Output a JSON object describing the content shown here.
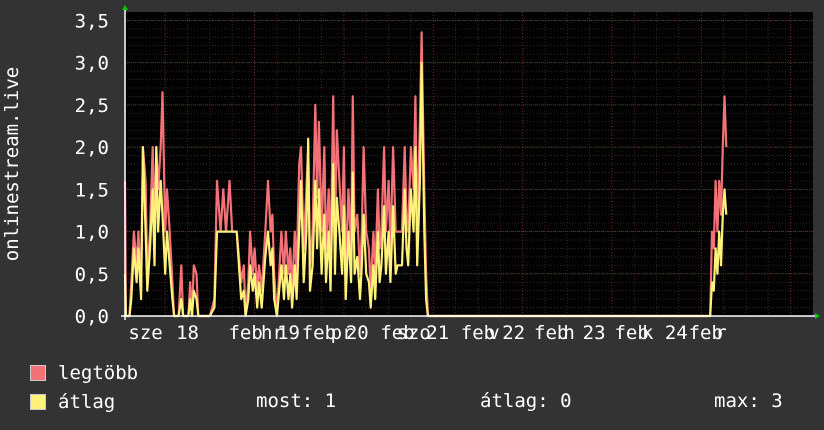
{
  "colors": {
    "background": "#333333",
    "plot_background": "#000000",
    "grid": "#4a2a2a",
    "axis": "#ffffff",
    "arrow": "#00cc00",
    "max_series": "#f27278",
    "avg_series": "#fff27a"
  },
  "legend": {
    "max_label": "legtöbb",
    "avg_label": "átlag",
    "now_label": "most: 1",
    "avg_stat_label": "átlag: 0",
    "max_stat_label": "max: 3"
  },
  "chart_data": {
    "type": "line",
    "ylabel": "onlinestream.live",
    "ylim": [
      0,
      3.6
    ],
    "yticks": [
      "0,0",
      "0,5",
      "1,0",
      "1,5",
      "2,0",
      "2,5",
      "3,0",
      "3,5"
    ],
    "xlim": [
      17.55,
      25.25
    ],
    "x_tick_labels": [
      {
        "x": 17.78,
        "label": "sze"
      },
      {
        "x": 18.25,
        "label": "18"
      },
      {
        "x": 18.9,
        "label": "feb"
      },
      {
        "x": 19.2,
        "label": "hr"
      },
      {
        "x": 19.38,
        "label": "19"
      },
      {
        "x": 19.72,
        "label": "feb"
      },
      {
        "x": 19.98,
        "label": "pr"
      },
      {
        "x": 20.15,
        "label": "20"
      },
      {
        "x": 20.6,
        "label": "feb"
      },
      {
        "x": 20.78,
        "label": "szo"
      },
      {
        "x": 21.05,
        "label": "21"
      },
      {
        "x": 21.5,
        "label": "feb"
      },
      {
        "x": 21.68,
        "label": "v"
      },
      {
        "x": 21.9,
        "label": "22"
      },
      {
        "x": 22.32,
        "label": "feb"
      },
      {
        "x": 22.52,
        "label": "h"
      },
      {
        "x": 22.8,
        "label": "23"
      },
      {
        "x": 23.22,
        "label": "feb"
      },
      {
        "x": 23.4,
        "label": "k"
      },
      {
        "x": 23.72,
        "label": "24"
      },
      {
        "x": 24.05,
        "label": "feb"
      },
      {
        "x": 24.22,
        "label": "r"
      }
    ],
    "series": [
      {
        "name": "legtöbb",
        "color": "#f27278",
        "points": [
          [
            17.55,
            1.6
          ],
          [
            17.56,
            0
          ],
          [
            17.6,
            0
          ],
          [
            17.62,
            0.4
          ],
          [
            17.65,
            1.0
          ],
          [
            17.68,
            0.6
          ],
          [
            17.7,
            1.0
          ],
          [
            17.73,
            0.3
          ],
          [
            17.75,
            2.0
          ],
          [
            17.78,
            1.6
          ],
          [
            17.8,
            0.5
          ],
          [
            17.83,
            1.0
          ],
          [
            17.86,
            2.0
          ],
          [
            17.88,
            0.9
          ],
          [
            17.9,
            2.0
          ],
          [
            17.92,
            1.5
          ],
          [
            17.95,
            2.0
          ],
          [
            17.97,
            2.65
          ],
          [
            18.0,
            1.0
          ],
          [
            18.02,
            1.5
          ],
          [
            18.05,
            1.0
          ],
          [
            18.08,
            0.4
          ],
          [
            18.1,
            0
          ],
          [
            18.15,
            0
          ],
          [
            18.18,
            0.6
          ],
          [
            18.2,
            0
          ],
          [
            18.26,
            0
          ],
          [
            18.28,
            0.4
          ],
          [
            18.3,
            0
          ],
          [
            18.32,
            0.6
          ],
          [
            18.35,
            0.5
          ],
          [
            18.37,
            0
          ],
          [
            18.5,
            0
          ],
          [
            18.55,
            0.2
          ],
          [
            18.58,
            1.6
          ],
          [
            18.62,
            1.0
          ],
          [
            18.65,
            1.5
          ],
          [
            18.68,
            1.0
          ],
          [
            18.72,
            1.6
          ],
          [
            18.75,
            1.0
          ],
          [
            18.8,
            1.0
          ],
          [
            18.85,
            0.4
          ],
          [
            18.88,
            0.6
          ],
          [
            18.9,
            0
          ],
          [
            18.93,
            0.4
          ],
          [
            18.95,
            1.0
          ],
          [
            18.98,
            0.5
          ],
          [
            19.0,
            0.8
          ],
          [
            19.03,
            0.3
          ],
          [
            19.05,
            0.6
          ],
          [
            19.08,
            0.3
          ],
          [
            19.12,
            1.0
          ],
          [
            19.15,
            1.6
          ],
          [
            19.18,
            1.0
          ],
          [
            19.2,
            1.2
          ],
          [
            19.22,
            0.5
          ],
          [
            19.25,
            0
          ],
          [
            19.3,
            1.0
          ],
          [
            19.33,
            0.5
          ],
          [
            19.35,
            1.0
          ],
          [
            19.38,
            0.5
          ],
          [
            19.4,
            0.8
          ],
          [
            19.42,
            0.3
          ],
          [
            19.45,
            1.0
          ],
          [
            19.47,
            0.5
          ],
          [
            19.5,
            1.8
          ],
          [
            19.52,
            2.0
          ],
          [
            19.55,
            0.8
          ],
          [
            19.58,
            1.5
          ],
          [
            19.6,
            2.0
          ],
          [
            19.62,
            0.6
          ],
          [
            19.65,
            1.0
          ],
          [
            19.68,
            2.5
          ],
          [
            19.7,
            1.4
          ],
          [
            19.72,
            2.3
          ],
          [
            19.75,
            1.0
          ],
          [
            19.78,
            2.0
          ],
          [
            19.8,
            0.8
          ],
          [
            19.83,
            1.5
          ],
          [
            19.85,
            0.6
          ],
          [
            19.88,
            2.6
          ],
          [
            19.9,
            1.0
          ],
          [
            19.92,
            2.2
          ],
          [
            19.95,
            1.6
          ],
          [
            19.98,
            1.0
          ],
          [
            20.0,
            2.0
          ],
          [
            20.02,
            0.5
          ],
          [
            20.05,
            1.5
          ],
          [
            20.08,
            0.8
          ],
          [
            20.1,
            2.6
          ],
          [
            20.12,
            1.0
          ],
          [
            20.15,
            1.2
          ],
          [
            20.18,
            0.5
          ],
          [
            20.2,
            1.0
          ],
          [
            20.22,
            2.0
          ],
          [
            20.25,
            1.0
          ],
          [
            20.28,
            0.8
          ],
          [
            20.3,
            0.3
          ],
          [
            20.33,
            1.0
          ],
          [
            20.35,
            0.5
          ],
          [
            20.38,
            1.5
          ],
          [
            20.4,
            0.8
          ],
          [
            20.42,
            1.0
          ],
          [
            20.45,
            2.0
          ],
          [
            20.47,
            1.0
          ],
          [
            20.5,
            1.6
          ],
          [
            20.52,
            0.8
          ],
          [
            20.55,
            2.0
          ],
          [
            20.58,
            1.0
          ],
          [
            20.6,
            1.0
          ],
          [
            20.65,
            1.0
          ],
          [
            20.68,
            2.0
          ],
          [
            20.7,
            1.2
          ],
          [
            20.72,
            1.0
          ],
          [
            20.75,
            2.0
          ],
          [
            20.78,
            1.5
          ],
          [
            20.8,
            2.6
          ],
          [
            20.82,
            1.0
          ],
          [
            20.85,
            2.3
          ],
          [
            20.87,
            3.36
          ],
          [
            20.9,
            1.5
          ],
          [
            20.92,
            0.5
          ],
          [
            20.94,
            0
          ],
          [
            22.8,
            0
          ],
          [
            24.1,
            0
          ],
          [
            24.12,
            1.0
          ],
          [
            24.14,
            0.8
          ],
          [
            24.16,
            1.6
          ],
          [
            24.18,
            1.0
          ],
          [
            24.2,
            1.6
          ],
          [
            24.22,
            1.2
          ],
          [
            24.24,
            2.0
          ],
          [
            24.26,
            2.6
          ],
          [
            24.28,
            2.0
          ]
        ]
      },
      {
        "name": "átlag",
        "color": "#fff27a",
        "points": [
          [
            17.55,
            0.5
          ],
          [
            17.56,
            0
          ],
          [
            17.6,
            0
          ],
          [
            17.62,
            0.2
          ],
          [
            17.65,
            0.8
          ],
          [
            17.68,
            0.4
          ],
          [
            17.7,
            0.8
          ],
          [
            17.73,
            0.2
          ],
          [
            17.75,
            2.0
          ],
          [
            17.78,
            1.0
          ],
          [
            17.8,
            0.3
          ],
          [
            17.83,
            0.8
          ],
          [
            17.86,
            1.5
          ],
          [
            17.88,
            0.6
          ],
          [
            17.9,
            2.0
          ],
          [
            17.92,
            1.0
          ],
          [
            17.95,
            1.6
          ],
          [
            17.97,
            1.2
          ],
          [
            18.0,
            0.5
          ],
          [
            18.02,
            1.0
          ],
          [
            18.05,
            0.6
          ],
          [
            18.08,
            0.2
          ],
          [
            18.1,
            0
          ],
          [
            18.15,
            0
          ],
          [
            18.18,
            0.2
          ],
          [
            18.2,
            0
          ],
          [
            18.26,
            0
          ],
          [
            18.28,
            0.2
          ],
          [
            18.3,
            0
          ],
          [
            18.32,
            0.3
          ],
          [
            18.35,
            0.2
          ],
          [
            18.37,
            0
          ],
          [
            18.5,
            0
          ],
          [
            18.55,
            0.1
          ],
          [
            18.58,
            1.0
          ],
          [
            18.62,
            1.0
          ],
          [
            18.65,
            1.0
          ],
          [
            18.68,
            1.0
          ],
          [
            18.72,
            1.0
          ],
          [
            18.75,
            1.0
          ],
          [
            18.8,
            1.0
          ],
          [
            18.85,
            0.2
          ],
          [
            18.88,
            0.3
          ],
          [
            18.9,
            0
          ],
          [
            18.93,
            0.2
          ],
          [
            18.95,
            0.6
          ],
          [
            18.98,
            0.3
          ],
          [
            19.0,
            0.5
          ],
          [
            19.03,
            0.1
          ],
          [
            19.05,
            0.4
          ],
          [
            19.08,
            0.1
          ],
          [
            19.12,
            0.7
          ],
          [
            19.15,
            1.0
          ],
          [
            19.18,
            0.6
          ],
          [
            19.2,
            0.8
          ],
          [
            19.22,
            0.2
          ],
          [
            19.25,
            0
          ],
          [
            19.3,
            0.6
          ],
          [
            19.33,
            0.2
          ],
          [
            19.35,
            0.6
          ],
          [
            19.38,
            0.2
          ],
          [
            19.4,
            0.5
          ],
          [
            19.42,
            0.1
          ],
          [
            19.45,
            0.6
          ],
          [
            19.47,
            0.2
          ],
          [
            19.5,
            1.0
          ],
          [
            19.52,
            1.6
          ],
          [
            19.55,
            0.4
          ],
          [
            19.58,
            1.0
          ],
          [
            19.6,
            2.1
          ],
          [
            19.62,
            0.3
          ],
          [
            19.65,
            0.6
          ],
          [
            19.68,
            1.6
          ],
          [
            19.7,
            0.8
          ],
          [
            19.72,
            1.5
          ],
          [
            19.75,
            0.5
          ],
          [
            19.78,
            1.2
          ],
          [
            19.8,
            0.4
          ],
          [
            19.83,
            1.0
          ],
          [
            19.85,
            0.3
          ],
          [
            19.88,
            1.8
          ],
          [
            19.9,
            0.5
          ],
          [
            19.92,
            1.4
          ],
          [
            19.95,
            1.0
          ],
          [
            19.98,
            0.5
          ],
          [
            20.0,
            1.3
          ],
          [
            20.02,
            0.2
          ],
          [
            20.05,
            1.0
          ],
          [
            20.08,
            0.4
          ],
          [
            20.1,
            1.7
          ],
          [
            20.12,
            0.5
          ],
          [
            20.15,
            0.7
          ],
          [
            20.18,
            0.2
          ],
          [
            20.2,
            0.6
          ],
          [
            20.22,
            1.2
          ],
          [
            20.25,
            0.5
          ],
          [
            20.28,
            0.4
          ],
          [
            20.3,
            0.1
          ],
          [
            20.33,
            0.6
          ],
          [
            20.35,
            0.2
          ],
          [
            20.38,
            1.0
          ],
          [
            20.4,
            0.4
          ],
          [
            20.42,
            0.6
          ],
          [
            20.45,
            1.3
          ],
          [
            20.47,
            0.5
          ],
          [
            20.5,
            1.0
          ],
          [
            20.52,
            0.4
          ],
          [
            20.55,
            1.3
          ],
          [
            20.58,
            0.5
          ],
          [
            20.6,
            0.6
          ],
          [
            20.65,
            0.6
          ],
          [
            20.68,
            1.5
          ],
          [
            20.7,
            0.8
          ],
          [
            20.72,
            0.6
          ],
          [
            20.75,
            1.5
          ],
          [
            20.78,
            1.0
          ],
          [
            20.8,
            2.0
          ],
          [
            20.82,
            0.6
          ],
          [
            20.85,
            1.6
          ],
          [
            20.87,
            3.0
          ],
          [
            20.9,
            1.0
          ],
          [
            20.92,
            0.2
          ],
          [
            20.94,
            0
          ],
          [
            22.8,
            0
          ],
          [
            24.1,
            0
          ],
          [
            24.12,
            0.4
          ],
          [
            24.14,
            0.3
          ],
          [
            24.16,
            0.8
          ],
          [
            24.18,
            0.5
          ],
          [
            24.2,
            1.0
          ],
          [
            24.22,
            0.6
          ],
          [
            24.24,
            1.2
          ],
          [
            24.26,
            1.5
          ],
          [
            24.28,
            1.2
          ]
        ]
      }
    ]
  }
}
